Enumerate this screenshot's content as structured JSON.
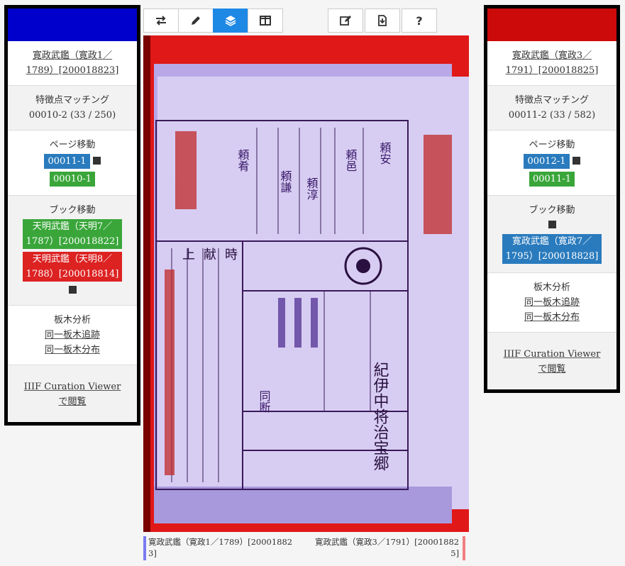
{
  "left": {
    "header_color": "#0000cc",
    "book_link": [
      "寛政武鑑（寛政1／",
      "1789）[200018823]"
    ],
    "feature_title": "特徴点マッチング",
    "feature_value": "00010-2 (33 / 250)",
    "page_move_title": "ページ移動",
    "page_next": "00011-1",
    "page_prev": "00010-1",
    "book_move_title": "ブック移動",
    "book_a": [
      "天明武鑑（天明7／",
      "1787）[200018822]"
    ],
    "book_b": [
      "天明武鑑（天明8／",
      "1788）[200018814]"
    ],
    "block_title": "板木分析",
    "block_trace": "同一板木追跡",
    "block_dist": "同一板木分布",
    "curation": [
      "IIIF Curation Viewer",
      "で閲覧"
    ]
  },
  "right": {
    "header_color": "#cc0a0a",
    "book_link": [
      "寛政武鑑（寛政3／",
      "1791）[200018825]"
    ],
    "feature_title": "特徴点マッチング",
    "feature_value": "00011-2 (33 / 582)",
    "page_move_title": "ページ移動",
    "page_next": "00012-1",
    "page_prev": "00011-1",
    "book_move_title": "ブック移動",
    "book_a": [
      "寛政武鑑（寛政7／",
      "1795）[200018828]"
    ],
    "block_title": "板木分析",
    "block_trace": "同一板木追跡",
    "block_dist": "同一板木分布",
    "curation": [
      "IIIF Curation Viewer",
      "で閲覧"
    ]
  },
  "toolbar": {
    "icons": [
      "swap-icon",
      "pencil-icon",
      "layers-icon",
      "columns-icon",
      "edit-icon",
      "download-icon",
      "help-icon"
    ],
    "active_color": "#1e88e5"
  },
  "viewer": {
    "page_text": [
      "紀伊中将治宝郷",
      "上献時",
      "頼安",
      "頼邑",
      "頼淳",
      "頼謙",
      "頼肴",
      "同断"
    ]
  },
  "captions": {
    "left": [
      "寛政武鑑（寛政1／1789）[20001882",
      "3]"
    ],
    "left_color": "#7a7af0",
    "right": [
      "寛政武鑑（寛政3／1791）[20001882",
      "5]"
    ],
    "right_color": "#f08080"
  }
}
